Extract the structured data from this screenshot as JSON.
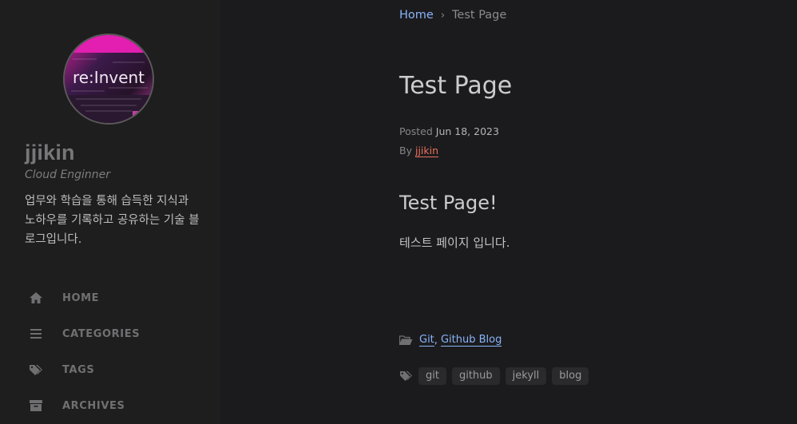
{
  "sidebar": {
    "site_title": "jjikin",
    "subtitle": "Cloud Enginner",
    "description": "업무와 학습을 통해 습득한 지식과 노하우를 기록하고 공유하는 기술 블로그입니다.",
    "avatar_text": "re:Invent",
    "nav": [
      {
        "label": "HOME",
        "icon": "home-icon"
      },
      {
        "label": "CATEGORIES",
        "icon": "list-icon"
      },
      {
        "label": "TAGS",
        "icon": "tags-icon"
      },
      {
        "label": "ARCHIVES",
        "icon": "archive-icon"
      }
    ]
  },
  "breadcrumb": {
    "home": "Home",
    "separator": "›",
    "current": "Test Page"
  },
  "post": {
    "title": "Test Page",
    "posted_label": "Posted",
    "date": "Jun 18, 2023",
    "by_label": "By",
    "author": "jjikin",
    "heading": "Test Page!",
    "body": "테스트 페이지 입니다."
  },
  "categories": [
    "Git",
    "Github Blog"
  ],
  "tags": [
    "git",
    "github",
    "jekyll",
    "blog"
  ],
  "colors": {
    "link": "#8ab4f8",
    "author_link": "#e8705a",
    "sidebar_bg": "#1e1e1e",
    "main_bg": "#1b1b1e"
  }
}
